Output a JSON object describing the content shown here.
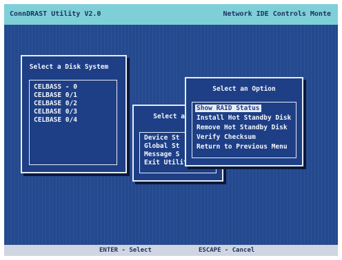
{
  "title_bar": {
    "left": "ConnDRAST Utility V2.0",
    "right": "Network IDE Controls Monte"
  },
  "disk_window": {
    "title": "Select a Disk System",
    "items": [
      "CELBASS - 0",
      "CELBASE 0/1",
      "CELBASE 0/2",
      "CELBASE 0/3",
      "CELBASE 0/4"
    ]
  },
  "main_menu": {
    "title": "Select an",
    "items": [
      "Device St",
      "Global St",
      "Message S",
      "Exit Utility"
    ]
  },
  "option_window": {
    "title": "Select an Option",
    "items": [
      "Show RAID Status",
      "Install Hot Standby Disk",
      "Remove Hot Standby Disk",
      "Verify Checksum",
      "Return to Previous Menu"
    ]
  },
  "status_bar": {
    "enter_hint": "ENTER - Select",
    "escape_hint": "ESCAPE - Cancel"
  },
  "colors": {
    "screen_bg": "#24498f",
    "title_bar_bg": "#7ecfd8",
    "window_border": "#e8edf5",
    "text": "#f4f6fb"
  }
}
